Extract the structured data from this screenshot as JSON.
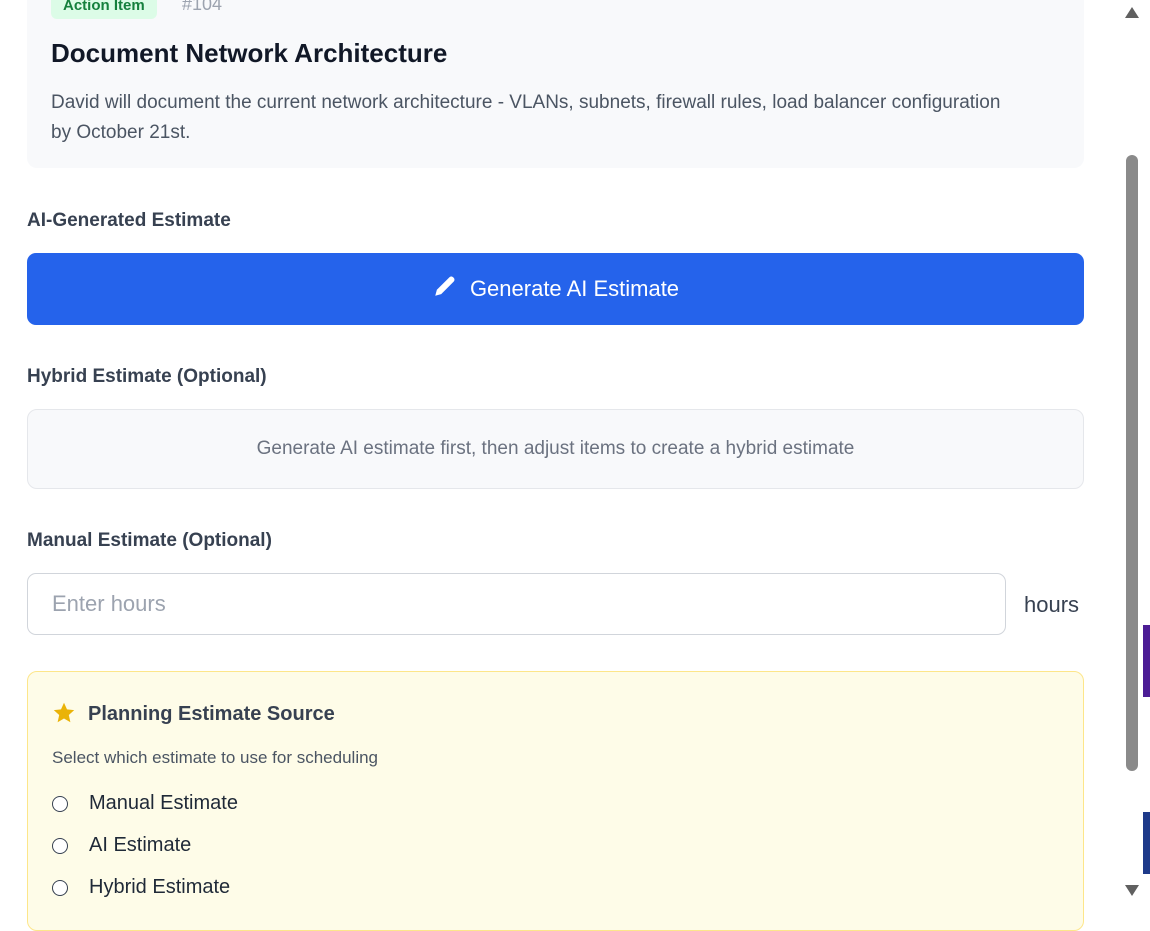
{
  "action_item": {
    "badge": "Action Item",
    "number": "#104",
    "title": "Document Network Architecture",
    "description": "David will document the current network architecture - VLANs, subnets, firewall rules, load balancer configuration by October 21st."
  },
  "ai_section": {
    "label": "AI-Generated Estimate",
    "button_label": "Generate AI Estimate",
    "button_icon": "pencil-icon"
  },
  "hybrid_section": {
    "label": "Hybrid Estimate (Optional)",
    "placeholder_text": "Generate AI estimate first, then adjust items to create a hybrid estimate"
  },
  "manual_section": {
    "label": "Manual Estimate (Optional)",
    "input_placeholder": "Enter hours",
    "input_value": "",
    "unit": "hours"
  },
  "planning_source": {
    "icon": "star-icon",
    "title": "Planning Estimate Source",
    "subtitle": "Select which estimate to use for scheduling",
    "options": [
      "Manual Estimate",
      "AI Estimate",
      "Hybrid Estimate"
    ],
    "selected": ""
  },
  "colors": {
    "primary": "#2563eb",
    "badge_bg": "#dcfce7",
    "badge_text": "#15803d",
    "source_bg": "#fefce8",
    "star": "#eab308"
  }
}
